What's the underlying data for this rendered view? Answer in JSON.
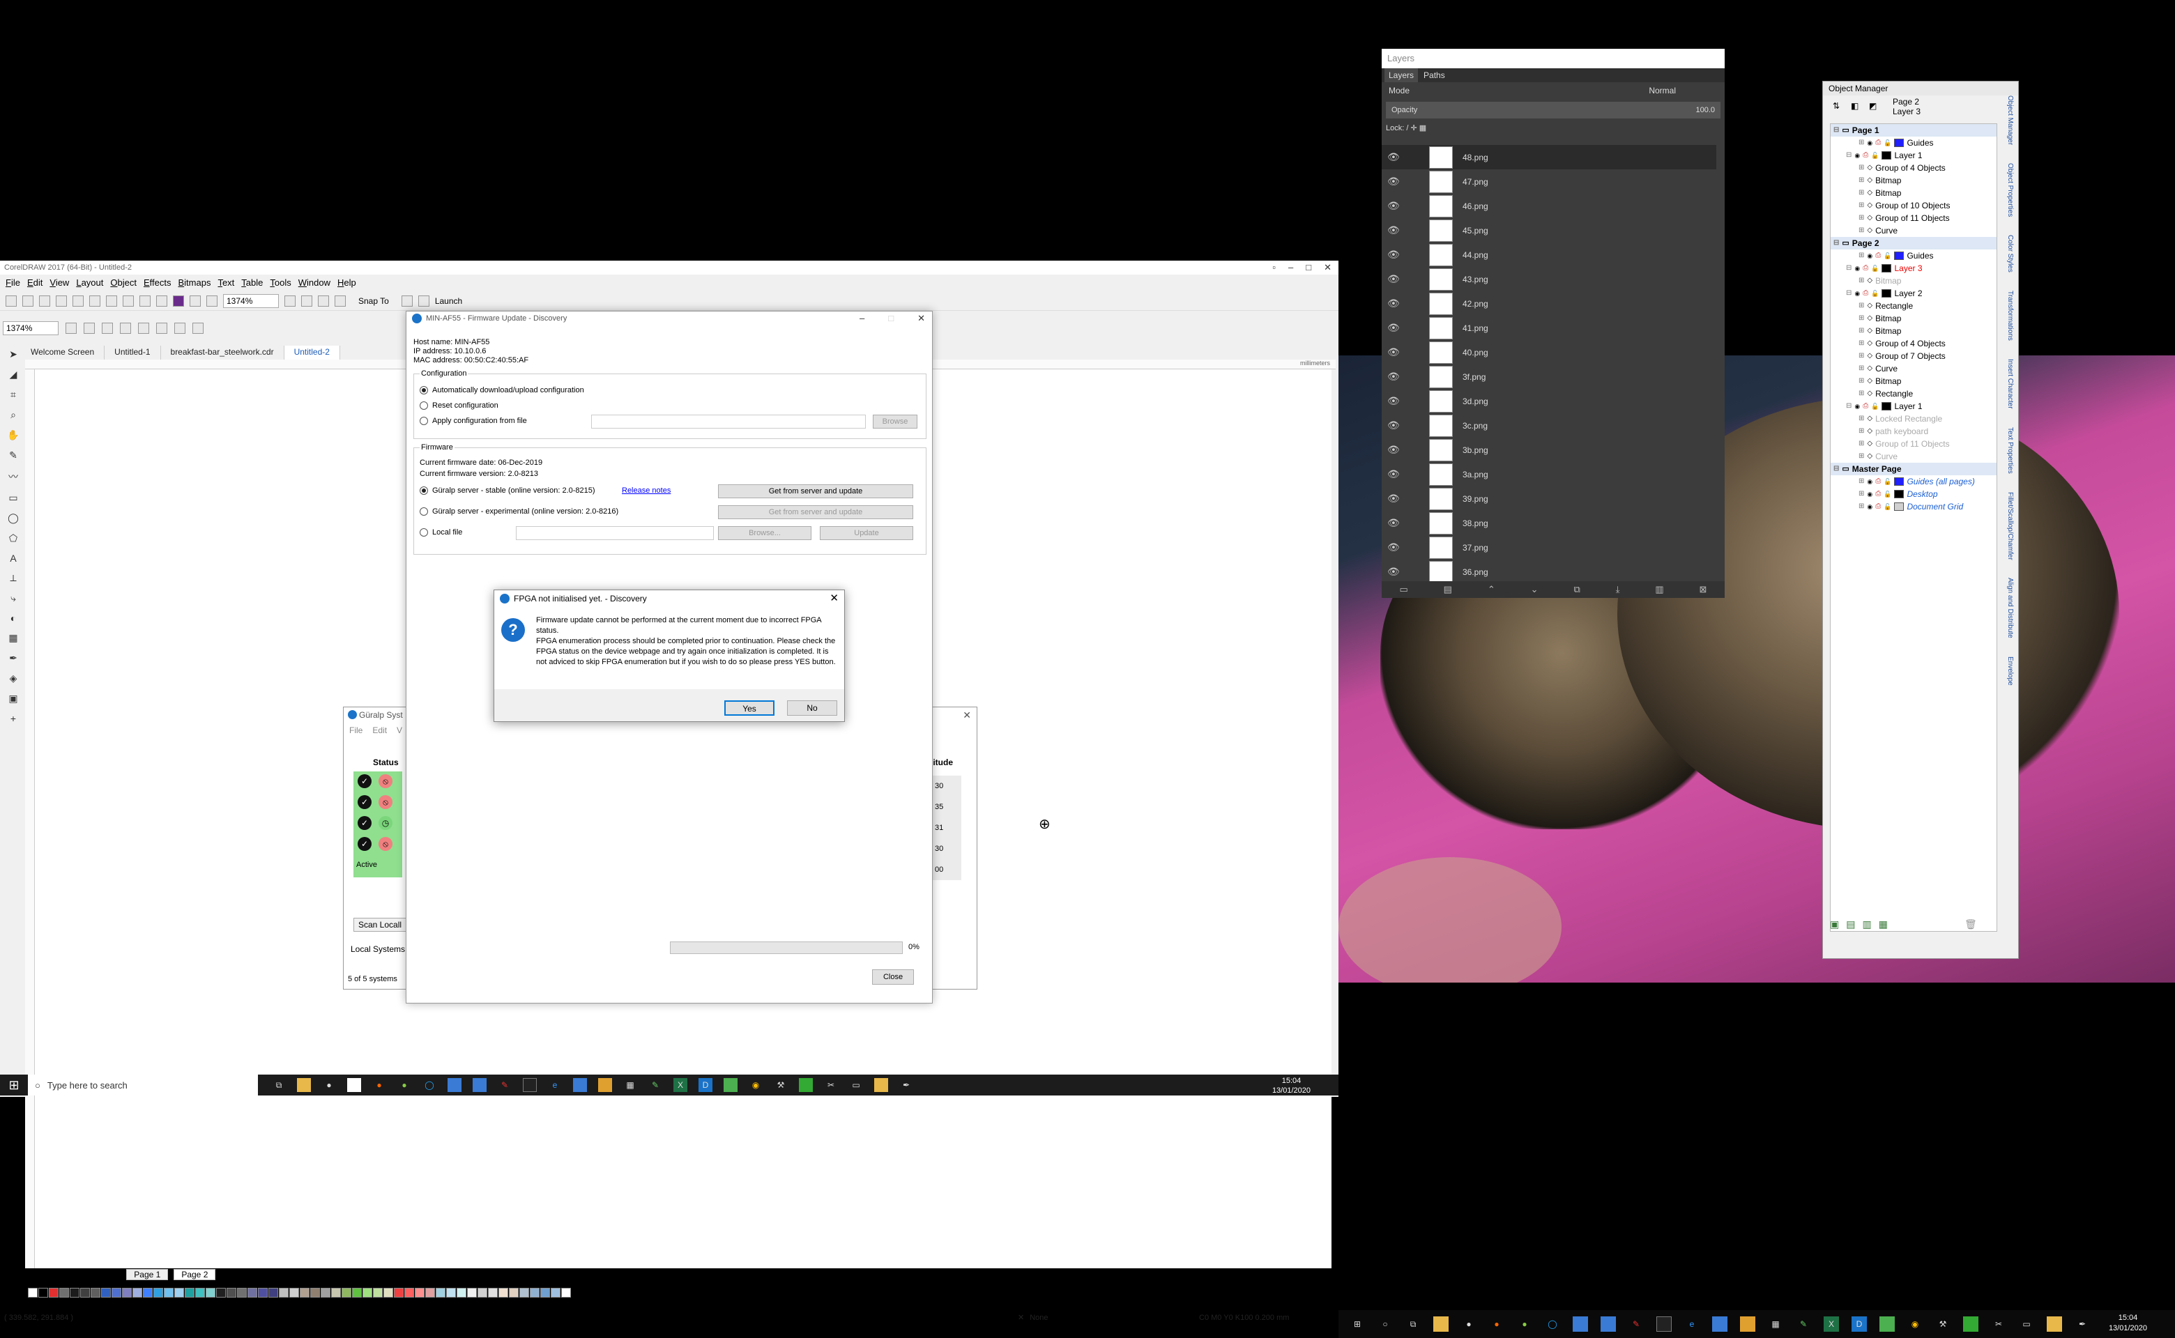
{
  "coreldraw": {
    "title": "CorelDRAW 2017 (64-Bit) - Untitled-2",
    "menu": [
      "File",
      "Edit",
      "View",
      "Layout",
      "Object",
      "Effects",
      "Bitmaps",
      "Text",
      "Table",
      "Tools",
      "Window",
      "Help"
    ],
    "zoom": "1374%",
    "zoom2": "1374%",
    "snap_to": "Snap To",
    "launch": "Launch",
    "tabs": [
      "Welcome Screen",
      "Untitled-1",
      "breakfast-bar_steelwork.cdr",
      "Untitled-2"
    ],
    "ruler_unit": "millimeters",
    "page_counter": "2  of  2",
    "pages": [
      "Page 1",
      "Page 2"
    ],
    "status_coords": "( 339.582, 291.884 )",
    "fill_none": "None",
    "outline": "C0 M0 Y0 K100  0.200 mm",
    "palette": [
      "#ffffff",
      "#000000",
      "#e03030",
      "#707070",
      "#1c1c1c",
      "#404040",
      "#606060",
      "#3060c0",
      "#5070d0",
      "#8080c0",
      "#a0b0e0",
      "#4080ff",
      "#30a0e0",
      "#70c0f0",
      "#a0d0f0",
      "#20a0a0",
      "#40c0c0",
      "#80d0d0",
      "#202020",
      "#505050",
      "#707070",
      "#7070a0",
      "#5050a0",
      "#404080",
      "#c0c0c0",
      "#d0d0d0",
      "#b0a090",
      "#908070",
      "#a0a0a0",
      "#c8c8b0",
      "#90b860",
      "#60c040",
      "#a0e080",
      "#c0e0a0",
      "#e0e0c0",
      "#f04040",
      "#ff6060",
      "#ff9090",
      "#e0a0a0",
      "#a0d0e0",
      "#c0e0f0",
      "#d0f0f0",
      "#f0f0f0",
      "#d0d0d0",
      "#e0e0e0",
      "#f0e0d0",
      "#e0d0c0",
      "#b0c0d0",
      "#90b0d0",
      "#70a0d0",
      "#a0c0e0",
      "#ffffff"
    ]
  },
  "taskbar_left": {
    "search_placeholder": "Type here to search",
    "time": "15:04",
    "date": "13/01/2020"
  },
  "taskbar_right": {
    "time": "15:04",
    "date": "13/01/2020"
  },
  "firmware": {
    "title": "MIN-AF55 - Firmware Update - Discovery",
    "host": "Host name:  MIN-AF55",
    "ip": "IP address:  10.10.0.6",
    "mac": "MAC address:  00:50:C2:40:55:AF",
    "config_legend": "Configuration",
    "opt_auto": "Automatically download/upload configuration",
    "opt_reset": "Reset configuration",
    "opt_apply": "Apply configuration from file",
    "browse": "Browse",
    "firmware_legend": "Firmware",
    "fw_date": "Current firmware date: 06-Dec-2019",
    "fw_version": "Current firmware version: 2.0-8213",
    "opt_stable": "Güralp server - stable (online version: 2.0-8215)",
    "release_notes": "Release notes",
    "get_update": "Get from server and update",
    "opt_experimental": "Güralp server - experimental (online version: 2.0-8216)",
    "get_update2": "Get from server and update",
    "opt_local": "Local file",
    "browse2": "Browse...",
    "update": "Update",
    "progress_pct": "0%",
    "progress": 0,
    "close": "Close"
  },
  "guralp": {
    "title": "Güralp Syst",
    "menu_file": "File",
    "menu_edit": "Edit",
    "menu_v": "V",
    "status_header": "Status",
    "magnitude_header": "gitude",
    "mag_values": [
      "30",
      "35",
      "31",
      "30",
      "00"
    ],
    "active": "Active",
    "scan": "Scan Locall",
    "local": "Local Systems",
    "count": "5 of 5 systems"
  },
  "fpga": {
    "title": "FPGA not initialised yet. - Discovery",
    "message": "Firmware update cannot be performed at the current moment due to incorrect FPGA status.\nFPGA enumeration process should be completed prior to continuation. Please check the FPGA status on the device webpage and try again once initialization is completed. It is not adviced to skip FPGA enumeration but if you wish to do so please press YES button.",
    "yes": "Yes",
    "no": "No"
  },
  "layers": {
    "title": "Layers",
    "tab_layers": "Layers",
    "tab_paths": "Paths",
    "mode_label": "Mode",
    "mode_value": "Normal",
    "opacity_label": "Opacity",
    "opacity_value": "100.0",
    "lock_label": "Lock:",
    "items": [
      "48.png",
      "47.png",
      "46.png",
      "45.png",
      "44.png",
      "43.png",
      "42.png",
      "41.png",
      "40.png",
      "3f.png",
      "3d.png",
      "3c.png",
      "3b.png",
      "3a.png",
      "39.png",
      "38.png",
      "37.png",
      "36.png"
    ]
  },
  "object_manager": {
    "title": "Object Manager",
    "current_page": "Page 2",
    "current_layer": "Layer 3",
    "nodes": [
      {
        "label": "Page 1",
        "indent": 0,
        "style": "bold"
      },
      {
        "label": "Guides",
        "indent": 2,
        "style": "",
        "swatch": "#2020ff"
      },
      {
        "label": "Layer 1",
        "indent": 1,
        "style": "",
        "swatch": "#000000"
      },
      {
        "label": "Group of 4 Objects",
        "indent": 2,
        "style": ""
      },
      {
        "label": "Bitmap",
        "indent": 2,
        "style": ""
      },
      {
        "label": "Bitmap",
        "indent": 2,
        "style": ""
      },
      {
        "label": "Group of 10 Objects",
        "indent": 2,
        "style": ""
      },
      {
        "label": "Group of 11 Objects",
        "indent": 2,
        "style": ""
      },
      {
        "label": "Curve",
        "indent": 2,
        "style": ""
      },
      {
        "label": "Page 2",
        "indent": 0,
        "style": "bold"
      },
      {
        "label": "Guides",
        "indent": 2,
        "style": "",
        "swatch": "#2020ff"
      },
      {
        "label": "Layer 3",
        "indent": 1,
        "style": "red",
        "swatch": "#000000"
      },
      {
        "label": "Bitmap",
        "indent": 2,
        "style": "gray"
      },
      {
        "label": "Layer 2",
        "indent": 1,
        "style": "",
        "swatch": "#000000"
      },
      {
        "label": "Rectangle",
        "indent": 2,
        "style": ""
      },
      {
        "label": "Bitmap",
        "indent": 2,
        "style": ""
      },
      {
        "label": "Bitmap",
        "indent": 2,
        "style": ""
      },
      {
        "label": "Group of 4 Objects",
        "indent": 2,
        "style": ""
      },
      {
        "label": "Group of 7 Objects",
        "indent": 2,
        "style": ""
      },
      {
        "label": "Curve",
        "indent": 2,
        "style": ""
      },
      {
        "label": "Bitmap",
        "indent": 2,
        "style": ""
      },
      {
        "label": "Rectangle",
        "indent": 2,
        "style": ""
      },
      {
        "label": "Layer 1",
        "indent": 1,
        "style": "",
        "swatch": "#000000"
      },
      {
        "label": "Locked Rectangle",
        "indent": 2,
        "style": "gray"
      },
      {
        "label": "path keyboard",
        "indent": 2,
        "style": "gray"
      },
      {
        "label": "Group of 11 Objects",
        "indent": 2,
        "style": "gray"
      },
      {
        "label": "Curve",
        "indent": 2,
        "style": "gray"
      },
      {
        "label": "Master Page",
        "indent": 0,
        "style": "bold"
      },
      {
        "label": "Guides (all pages)",
        "indent": 2,
        "style": "blue",
        "swatch": "#2020ff"
      },
      {
        "label": "Desktop",
        "indent": 2,
        "style": "blue",
        "swatch": "#000000"
      },
      {
        "label": "Document Grid",
        "indent": 2,
        "style": "blue",
        "swatch": "#d0d0d0"
      }
    ],
    "side_tabs": [
      "Object Manager",
      "Object Properties",
      "Color Styles",
      "Transformations",
      "Insert Character",
      "Text Properties",
      "Fillet/Scallop/Chamfer",
      "Align and Distribute",
      "Envelope"
    ]
  }
}
